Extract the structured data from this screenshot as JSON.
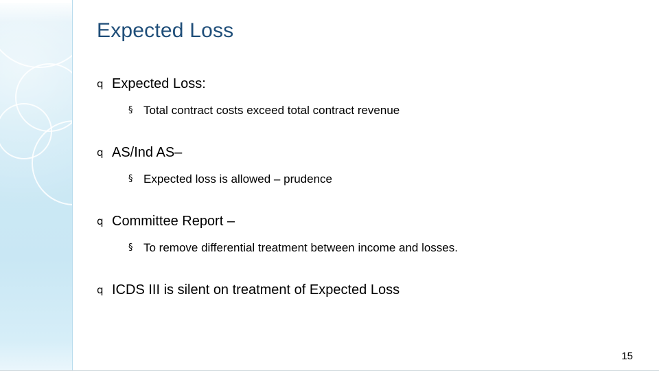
{
  "slide": {
    "title": "Expected Loss",
    "page_number": "15",
    "level1_bullet_glyph": "q",
    "level2_bullet_glyph": "§",
    "accent_color": "#1f4e79",
    "band_color": "#cde9f5",
    "blocks": [
      {
        "heading": "Expected Loss:",
        "sub": "Total contract costs exceed total contract revenue"
      },
      {
        "heading": "AS/Ind AS–",
        "sub": "Expected loss is allowed – prudence"
      },
      {
        "heading": "Committee Report –",
        "sub": "To remove differential treatment between income and losses."
      },
      {
        "heading": "ICDS III is silent on treatment of Expected Loss",
        "sub": ""
      }
    ]
  }
}
